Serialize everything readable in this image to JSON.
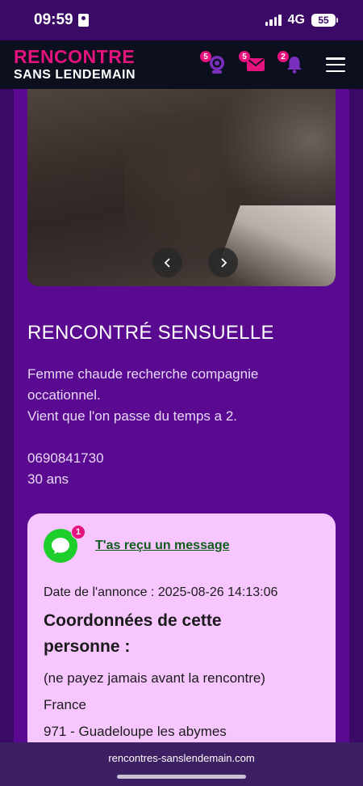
{
  "status_bar": {
    "time": "09:59",
    "network": "4G",
    "battery": "55"
  },
  "header": {
    "logo_line1": "RENCONTRE",
    "logo_line2": "SANS LENDEMAIN",
    "webcam_badge": "5",
    "messages_badge": "5",
    "notifications_badge": "2"
  },
  "ad": {
    "title": "RENCONTRÉ SENSUELLE",
    "description_lines": [
      "Femme chaude recherche compagnie occationnel.",
      "Vient que l'on passe du temps a 2.",
      "",
      "0690841730",
      "30 ans"
    ]
  },
  "card": {
    "message_badge": "1",
    "message_link": "T'as reçu un message",
    "date_label": "Date de l'annonce : 2025-08-26 14:13:06",
    "coords_title": "Coordonnées de cette personne :",
    "warning": "(ne payez jamais avant la rencontre)",
    "country": "France",
    "region": "971 - Guadeloupe les abymes"
  },
  "browser": {
    "url": "rencontres-sanslendemain.com"
  },
  "colors": {
    "brand_pink": "#e5137e",
    "panel_purple": "#5a0a90",
    "card_pink": "#f7c6ff",
    "header_dark": "#0c0f1e",
    "whatsapp_green": "#1ece2d"
  },
  "icons": [
    "webcam-icon",
    "envelope-icon",
    "bell-icon",
    "hamburger-menu-icon",
    "chevron-left-icon",
    "chevron-right-icon",
    "chat-bubble-icon"
  ]
}
